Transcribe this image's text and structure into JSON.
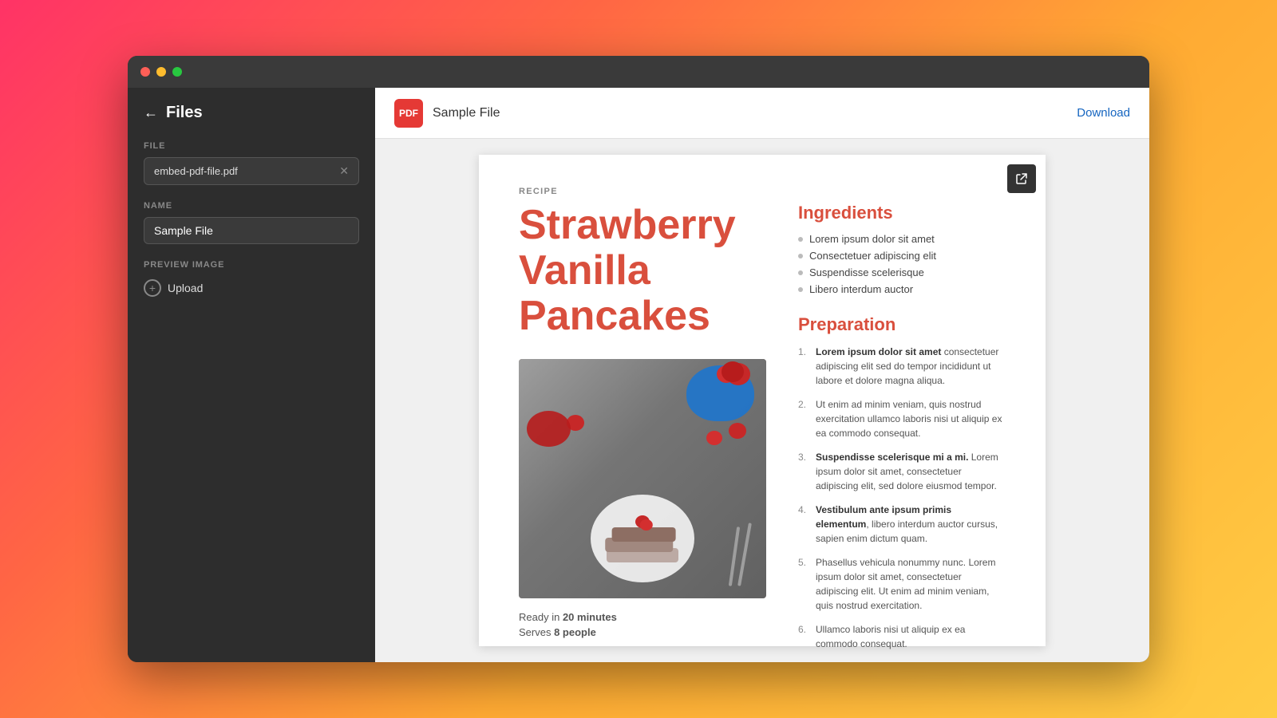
{
  "window": {
    "title": "Files"
  },
  "sidebar": {
    "back_label": "←",
    "title": "Files",
    "file_section_label": "FILE",
    "file_name": "embed-pdf-file.pdf",
    "name_section_label": "NAME",
    "name_value": "Sample File",
    "preview_section_label": "PREVIEW IMAGE",
    "upload_label": "Upload"
  },
  "header": {
    "file_label": "Sample File",
    "pdf_label": "PDF",
    "download_label": "Download"
  },
  "recipe": {
    "label": "RECIPE",
    "title_line1": "Strawberry",
    "title_line2": "Vanilla",
    "title_line3": "Pancakes",
    "ready_text": "Ready in",
    "ready_time": "20 minutes",
    "serves_text": "Serves",
    "serves_count": "8 people",
    "ingredients_title": "Ingredients",
    "ingredients": [
      "Lorem ipsum dolor sit amet",
      "Consectetuer adipiscing elit",
      "Suspendisse scelerisque",
      "Libero interdum auctor"
    ],
    "preparation_title": "Preparation",
    "steps": [
      {
        "bold_part": "Lorem ipsum dolor sit amet",
        "rest": " consectetuer adipiscing elit sed do tempor incididunt ut labore et dolore magna aliqua."
      },
      {
        "bold_part": "",
        "rest": "Ut enim ad minim veniam, quis nostrud exercitation ullamco laboris nisi ut aliquip ex ea commodo consequat."
      },
      {
        "bold_part": "Suspendisse scelerisque mi a mi.",
        "rest": " Lorem ipsum dolor sit amet, consectetuer adipiscing elit, sed dolore eiusmod tempor."
      },
      {
        "bold_part": "Vestibulum ante ipsum primis elementum",
        "rest": ", libero interdum auctor cursus, sapien enim dictum quam."
      },
      {
        "bold_part": "",
        "rest": "Phasellus vehicula nonummy nunc. Lorem ipsum dolor sit amet, consectetuer adipiscing elit. Ut enim ad minim veniam, quis nostrud exercitation."
      },
      {
        "bold_part": "",
        "rest": "Ullamco laboris nisi ut aliquip ex ea commodo consequat."
      }
    ]
  }
}
